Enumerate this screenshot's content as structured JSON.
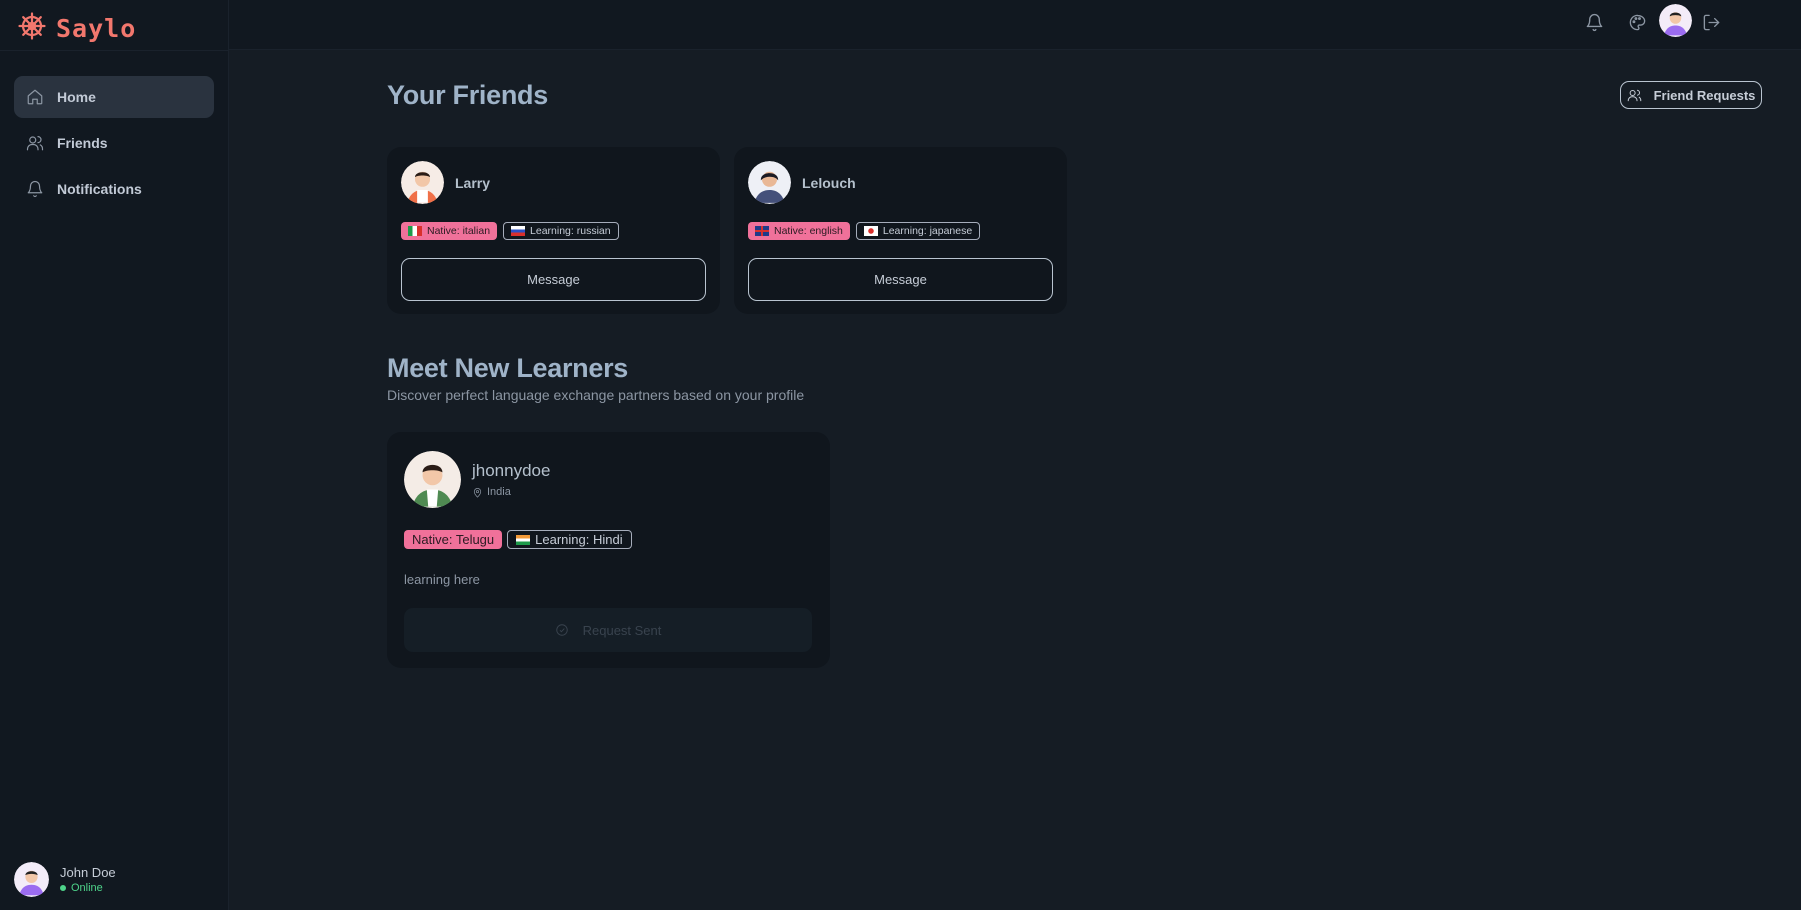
{
  "app": {
    "name": "Saylo"
  },
  "sidebar": {
    "items": [
      {
        "label": "Home",
        "icon": "home-icon",
        "active": true
      },
      {
        "label": "Friends",
        "icon": "users-icon",
        "active": false
      },
      {
        "label": "Notifications",
        "icon": "bell-icon",
        "active": false
      }
    ],
    "profile": {
      "name": "John Doe",
      "status": "Online"
    }
  },
  "topbar": {
    "icons": [
      "bell-icon",
      "palette-icon",
      "avatar",
      "logout-icon"
    ]
  },
  "friends_section": {
    "title": "Your Friends",
    "friend_requests_label": "Friend Requests",
    "friends": [
      {
        "name": "Larry",
        "native": "Native: italian",
        "learning": "Learning: russian",
        "native_flag": "italy-flag-icon",
        "learning_flag": "russia-flag-icon",
        "message_label": "Message"
      },
      {
        "name": "Lelouch",
        "native": "Native: english",
        "learning": "Learning: japanese",
        "native_flag": "uk-flag-icon",
        "learning_flag": "japan-flag-icon",
        "message_label": "Message"
      }
    ]
  },
  "learners_section": {
    "title": "Meet New Learners",
    "subtitle": "Discover perfect language exchange partners based on your profile",
    "learners": [
      {
        "name": "jhonnydoe",
        "location": "India",
        "native": "Native: Telugu",
        "learning": "Learning: Hindi",
        "learning_flag": "india-flag-icon",
        "bio": "learning here",
        "request_label": "Request Sent"
      }
    ]
  },
  "colors": {
    "accent": "#f2776d",
    "native_badge": "#f0719a",
    "online": "#4ed38a"
  }
}
